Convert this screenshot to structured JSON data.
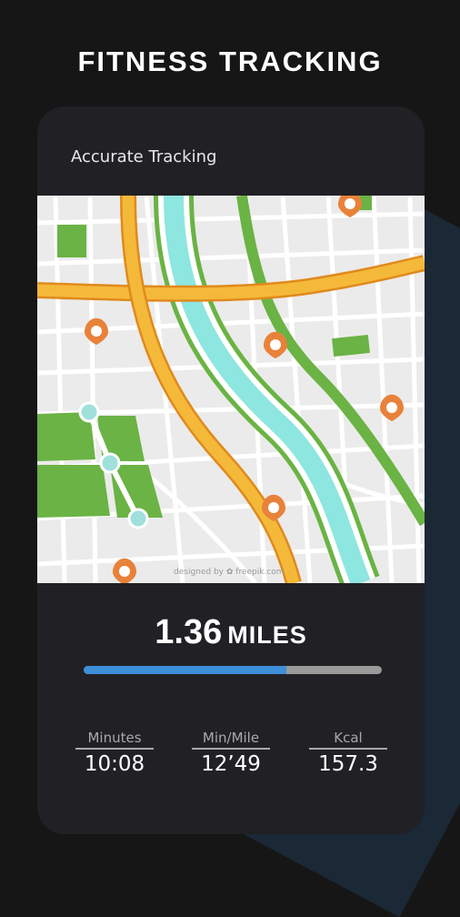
{
  "header": {
    "title": "FITNESS TRACKING"
  },
  "card": {
    "label": "Accurate Tracking",
    "map": {
      "watermark": "designed by ✿ freepik.com"
    }
  },
  "summary": {
    "distance_value": "1.36",
    "distance_unit": "MILES",
    "progress_fraction": 0.68
  },
  "stats": [
    {
      "label": "Minutes",
      "value": "10:08"
    },
    {
      "label": "Min/Mile",
      "value": "12’49"
    },
    {
      "label": "Kcal",
      "value": "157.3"
    }
  ],
  "colors": {
    "background": "#161616",
    "card": "#212024",
    "progress_fill": "#3d8fd8",
    "progress_track": "#9a9a9a",
    "route_orange": "#f5a623",
    "route_green": "#6ab344",
    "river": "#8ee6e0",
    "pin": "#e8823a"
  }
}
